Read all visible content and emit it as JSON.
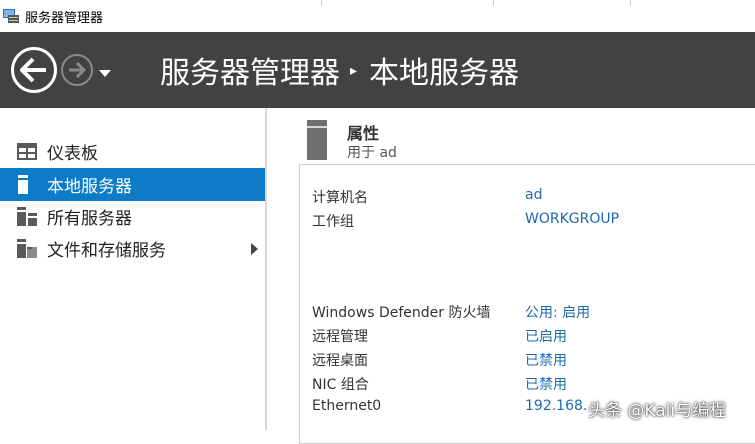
{
  "window": {
    "title": "服务器管理器"
  },
  "header": {
    "breadcrumb_root": "服务器管理器",
    "breadcrumb_separator": "▸",
    "breadcrumb_current": "本地服务器"
  },
  "sidebar": {
    "items": [
      {
        "label": "仪表板",
        "icon": "dashboard-icon"
      },
      {
        "label": "本地服务器",
        "icon": "server-icon",
        "active": true
      },
      {
        "label": "所有服务器",
        "icon": "servers-icon"
      },
      {
        "label": "文件和存储服务",
        "icon": "storage-icon",
        "expandable": true
      }
    ]
  },
  "properties": {
    "title": "属性",
    "subtitle": "用于 ad",
    "rows": [
      {
        "label": "计算机名",
        "value": "ad"
      },
      {
        "label": "工作组",
        "value": "WORKGROUP"
      },
      {
        "label": "Windows Defender 防火墙",
        "value": "公用: 启用"
      },
      {
        "label": "远程管理",
        "value": "已启用"
      },
      {
        "label": "远程桌面",
        "value": "已禁用"
      },
      {
        "label": "NIC 组合",
        "value": "已禁用"
      },
      {
        "label": "Ethernet0",
        "value": "192.168."
      }
    ]
  },
  "watermark": "头条 @Kali与编程",
  "colors": {
    "header_bg": "#424242",
    "active_item": "#0e7bc9",
    "link": "#1d6ab0"
  }
}
